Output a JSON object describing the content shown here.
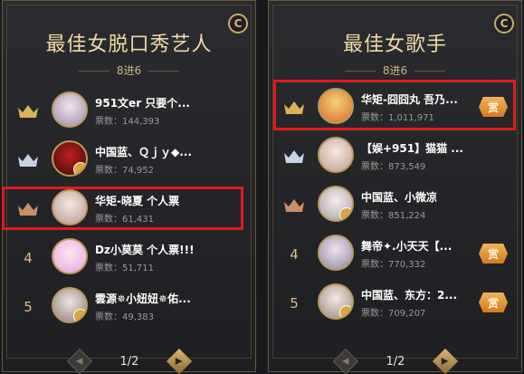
{
  "panels": [
    {
      "title": "最佳女脱口秀艺人",
      "subtitle": "8进6",
      "pager": "1/2",
      "rows": [
        {
          "rank": "1",
          "crown": "gold",
          "name": "951文er 只要个...",
          "votes": "票数：144,393",
          "shang": false
        },
        {
          "rank": "2",
          "crown": "silver",
          "name": "中国蓝、Ｑｊｙ◆...",
          "votes": "票数：74,952",
          "shang": false
        },
        {
          "rank": "3",
          "crown": "bronze",
          "name": "华矩-晓夏 个人票",
          "votes": "票数：61,431",
          "shang": false
        },
        {
          "rank": "4",
          "crown": "",
          "name": "Dz小莫莫 个人票!!!",
          "votes": "票数：51,711",
          "shang": false
        },
        {
          "rank": "5",
          "crown": "",
          "name": "雲源✵小妞妞✵佑...",
          "votes": "票数：49,383",
          "shang": false
        }
      ]
    },
    {
      "title": "最佳女歌手",
      "subtitle": "8进6",
      "pager": "1/2",
      "rows": [
        {
          "rank": "1",
          "crown": "gold",
          "name": "华矩-囧囧丸 吾乃...",
          "votes": "票数：1,011,971",
          "shang": true
        },
        {
          "rank": "2",
          "crown": "silver",
          "name": "【娱+951】猫猫 ...",
          "votes": "票数：873,549",
          "shang": false
        },
        {
          "rank": "3",
          "crown": "bronze",
          "name": "中国蓝、小微凉",
          "votes": "票数：851,224",
          "shang": false
        },
        {
          "rank": "4",
          "crown": "",
          "name": "舞帝✦.小天天【...",
          "votes": "票数：770,332",
          "shang": true
        },
        {
          "rank": "5",
          "crown": "",
          "name": "中国蓝、东方：2...",
          "votes": "票数：709,207",
          "shang": true
        }
      ]
    }
  ],
  "shang_label": "赏",
  "coin_label": "C",
  "avatar_icon": "user-avatar",
  "colors": {
    "gold": "#d9b35a",
    "silver": "#c5d4e6",
    "bronze": "#c8916a",
    "highlight": "#e11b1b",
    "shang": "#e89a3c"
  }
}
